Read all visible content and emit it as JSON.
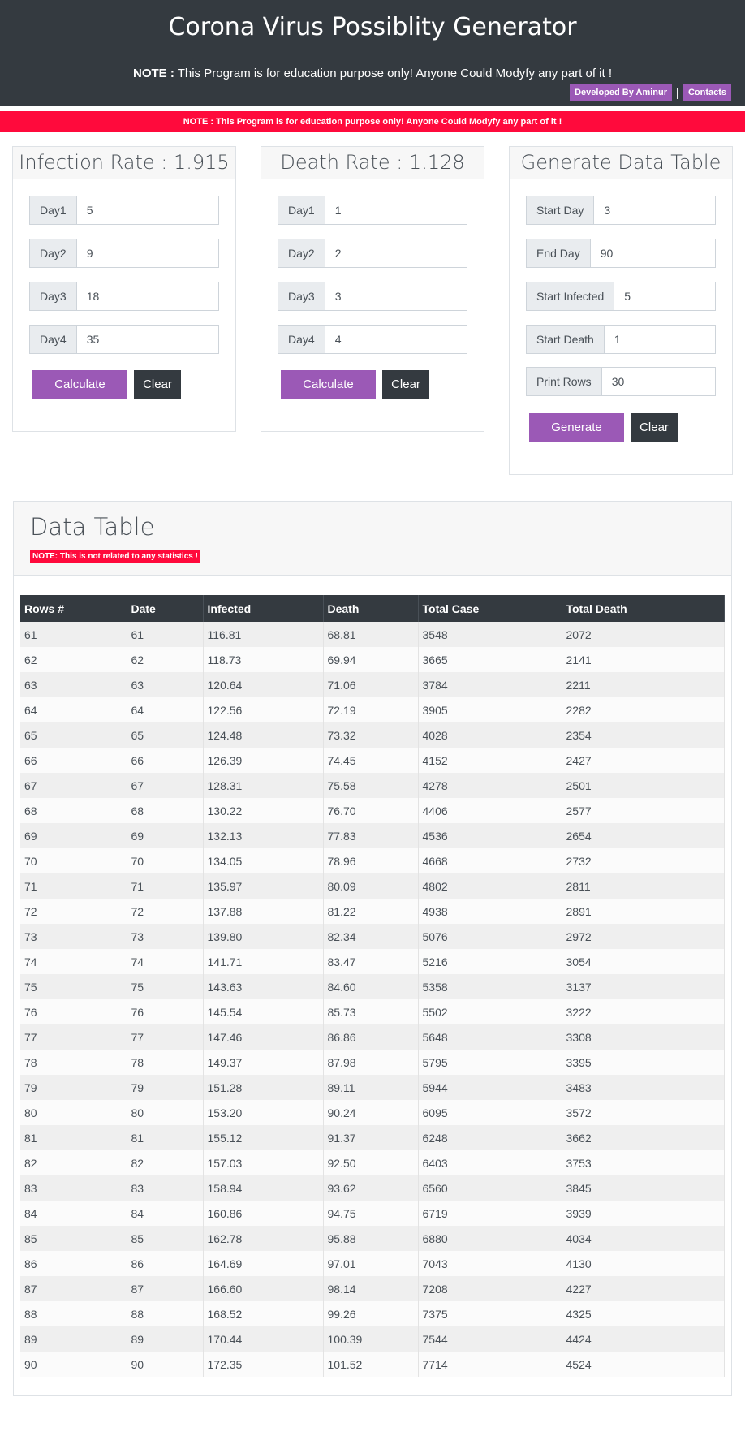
{
  "header": {
    "title": "Corona Virus Possiblity Generator",
    "note_label": "NOTE :",
    "note_text": " This Program is for education purpose only! Anyone Could Modyfy any part of it !",
    "developer_link": "Developed By Aminur",
    "separator": "|",
    "contacts_link": "Contacts"
  },
  "banner": {
    "label": "NOTE :",
    "text": " This Program is for education purpose only! Anyone Could Modyfy any part of it !"
  },
  "infection": {
    "title": "Infection Rate : 1.915",
    "fields": [
      {
        "label": "Day1",
        "value": "5"
      },
      {
        "label": "Day2",
        "value": "9"
      },
      {
        "label": "Day3",
        "value": "18"
      },
      {
        "label": "Day4",
        "value": "35"
      }
    ],
    "calculate": "Calculate",
    "clear": "Clear"
  },
  "death": {
    "title": "Death Rate : 1.128",
    "fields": [
      {
        "label": "Day1",
        "value": "1"
      },
      {
        "label": "Day2",
        "value": "2"
      },
      {
        "label": "Day3",
        "value": "3"
      },
      {
        "label": "Day4",
        "value": "4"
      }
    ],
    "calculate": "Calculate",
    "clear": "Clear"
  },
  "generate": {
    "title": "Generate Data Table",
    "fields": [
      {
        "label": "Start Day",
        "value": "3"
      },
      {
        "label": "End Day",
        "value": "90"
      },
      {
        "label": "Start Infected",
        "value": "5"
      },
      {
        "label": "Start Death",
        "value": "1"
      },
      {
        "label": "Print Rows",
        "value": "30"
      }
    ],
    "generate": "Generate",
    "clear": "Clear"
  },
  "data_table": {
    "title": "Data Table",
    "note": "NOTE: This is not related to any statistics !",
    "columns": [
      "Rows #",
      "Date",
      "Infected",
      "Death",
      "Total Case",
      "Total Death"
    ],
    "rows": [
      [
        "61",
        "61",
        "116.81",
        "68.81",
        "3548",
        "2072"
      ],
      [
        "62",
        "62",
        "118.73",
        "69.94",
        "3665",
        "2141"
      ],
      [
        "63",
        "63",
        "120.64",
        "71.06",
        "3784",
        "2211"
      ],
      [
        "64",
        "64",
        "122.56",
        "72.19",
        "3905",
        "2282"
      ],
      [
        "65",
        "65",
        "124.48",
        "73.32",
        "4028",
        "2354"
      ],
      [
        "66",
        "66",
        "126.39",
        "74.45",
        "4152",
        "2427"
      ],
      [
        "67",
        "67",
        "128.31",
        "75.58",
        "4278",
        "2501"
      ],
      [
        "68",
        "68",
        "130.22",
        "76.70",
        "4406",
        "2577"
      ],
      [
        "69",
        "69",
        "132.13",
        "77.83",
        "4536",
        "2654"
      ],
      [
        "70",
        "70",
        "134.05",
        "78.96",
        "4668",
        "2732"
      ],
      [
        "71",
        "71",
        "135.97",
        "80.09",
        "4802",
        "2811"
      ],
      [
        "72",
        "72",
        "137.88",
        "81.22",
        "4938",
        "2891"
      ],
      [
        "73",
        "73",
        "139.80",
        "82.34",
        "5076",
        "2972"
      ],
      [
        "74",
        "74",
        "141.71",
        "83.47",
        "5216",
        "3054"
      ],
      [
        "75",
        "75",
        "143.63",
        "84.60",
        "5358",
        "3137"
      ],
      [
        "76",
        "76",
        "145.54",
        "85.73",
        "5502",
        "3222"
      ],
      [
        "77",
        "77",
        "147.46",
        "86.86",
        "5648",
        "3308"
      ],
      [
        "78",
        "78",
        "149.37",
        "87.98",
        "5795",
        "3395"
      ],
      [
        "79",
        "79",
        "151.28",
        "89.11",
        "5944",
        "3483"
      ],
      [
        "80",
        "80",
        "153.20",
        "90.24",
        "6095",
        "3572"
      ],
      [
        "81",
        "81",
        "155.12",
        "91.37",
        "6248",
        "3662"
      ],
      [
        "82",
        "82",
        "157.03",
        "92.50",
        "6403",
        "3753"
      ],
      [
        "83",
        "83",
        "158.94",
        "93.62",
        "6560",
        "3845"
      ],
      [
        "84",
        "84",
        "160.86",
        "94.75",
        "6719",
        "3939"
      ],
      [
        "85",
        "85",
        "162.78",
        "95.88",
        "6880",
        "4034"
      ],
      [
        "86",
        "86",
        "164.69",
        "97.01",
        "7043",
        "4130"
      ],
      [
        "87",
        "87",
        "166.60",
        "98.14",
        "7208",
        "4227"
      ],
      [
        "88",
        "88",
        "168.52",
        "99.26",
        "7375",
        "4325"
      ],
      [
        "89",
        "89",
        "170.44",
        "100.39",
        "7544",
        "4424"
      ],
      [
        "90",
        "90",
        "172.35",
        "101.52",
        "7714",
        "4524"
      ]
    ]
  }
}
